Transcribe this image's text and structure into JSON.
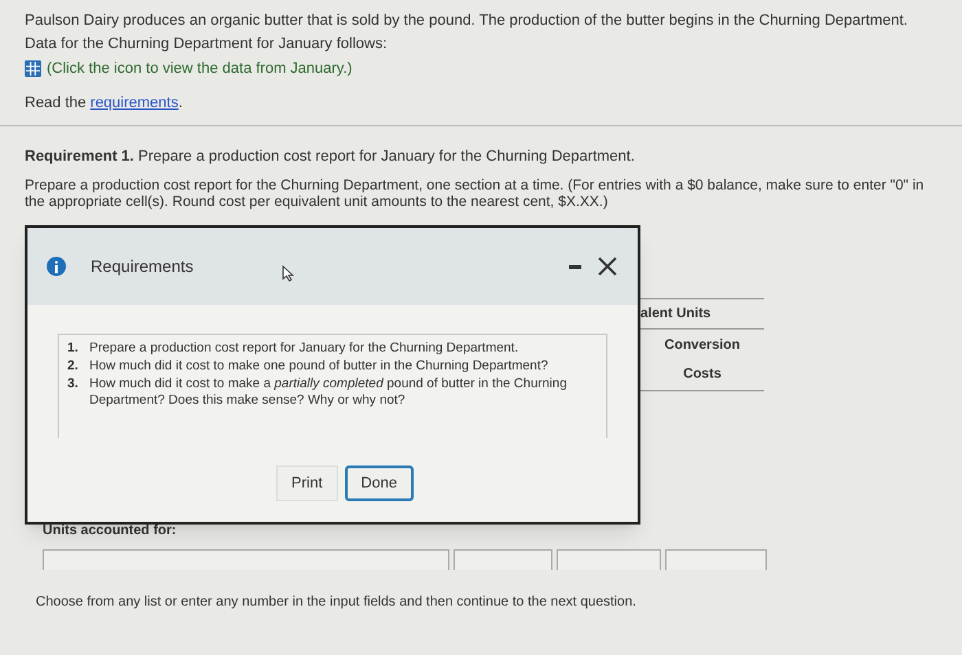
{
  "intro": {
    "text": "Paulson Dairy produces an organic butter that is sold by the pound. The production of the butter begins in the Churning Department.",
    "data_line": "Data for the Churning Department for January follows:",
    "data_link": "(Click the icon to view the data from January.)",
    "read_prefix": "Read the",
    "read_link": "requirements",
    "read_suffix": "."
  },
  "requirement": {
    "label": "Requirement 1.",
    "text": "Prepare a production cost report for January for the Churning Department.",
    "instructions": "Prepare a production cost report for the Churning Department, one section at a time. (For entries with a $0 balance, make sure to enter \"0\" in the appropriate cell(s). Round cost per equivalent unit amounts to the nearest cent, $X.XX.)"
  },
  "table": {
    "header": "alent Units",
    "columns": [
      "Conversion\nCosts"
    ],
    "section": "Units accounted for:"
  },
  "footer": "Choose from any list or enter any number in the input fields and then continue to the next question.",
  "dialog": {
    "title": "Requirements",
    "items": [
      {
        "number": "1.",
        "text": "Prepare a production cost report for January for the Churning Department."
      },
      {
        "number": "2.",
        "text": "How much did it cost to make one pound of butter in the Churning Department?"
      },
      {
        "number": "3.",
        "text": "How much did it cost to make a *partially completed* pound of butter in the Churning Department? Does this make sense? Why or why not?"
      }
    ],
    "buttons": [
      {
        "label": "Print",
        "selected": false
      },
      {
        "label": "Done",
        "selected": true
      }
    ]
  }
}
